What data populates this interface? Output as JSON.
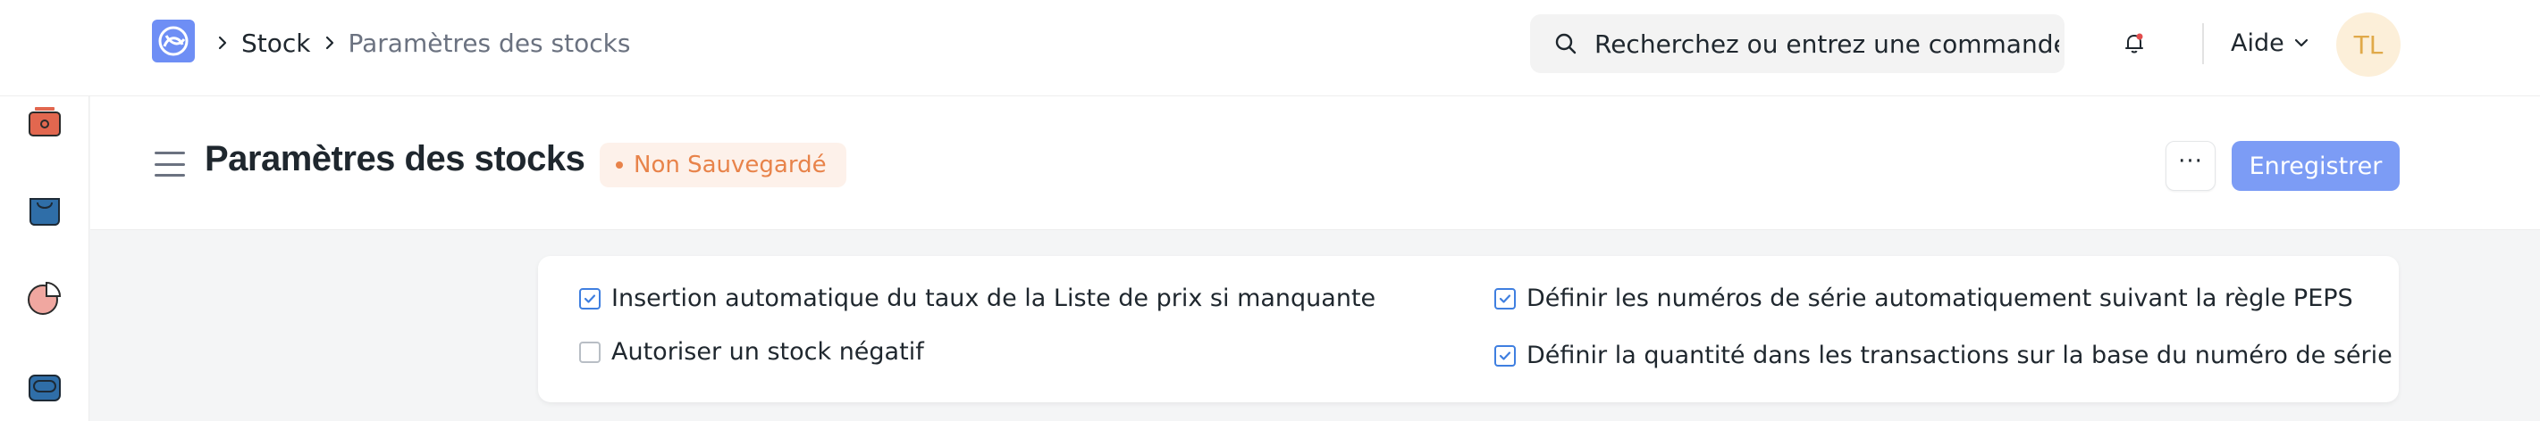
{
  "breadcrumb": {
    "items": [
      "Stock",
      "Paramètres des stocks"
    ]
  },
  "search": {
    "placeholder": "Recherchez ou entrez une commande"
  },
  "navbar": {
    "help_label": "Aide",
    "avatar_initials": "TL"
  },
  "page": {
    "title": "Paramètres des stocks",
    "status_badge": "Non Sauvegardé",
    "more_button": "···",
    "save_button": "Enregistrer"
  },
  "settings": {
    "left": [
      {
        "label": "Insertion automatique du taux de la Liste de prix si manquante",
        "checked": true
      },
      {
        "label": "Autoriser un stock négatif",
        "checked": false
      }
    ],
    "right": [
      {
        "label": "Définir les numéros de série automatiquement suivant la règle PEPS",
        "checked": true
      },
      {
        "label": "Définir la quantité dans les transactions sur la base du numéro de série",
        "checked": true
      }
    ]
  },
  "sidebar": {
    "icons": [
      "stock-box-icon",
      "shopping-bag-icon",
      "pie-chart-icon",
      "wallet-icon"
    ]
  },
  "colors": {
    "accent": "#7c9cf5",
    "badge_text": "#e8834a",
    "badge_bg": "#fdf1ea",
    "checkbox": "#3f7fe0",
    "avatar_bg": "#fcefd9",
    "avatar_text": "#e0a949"
  }
}
